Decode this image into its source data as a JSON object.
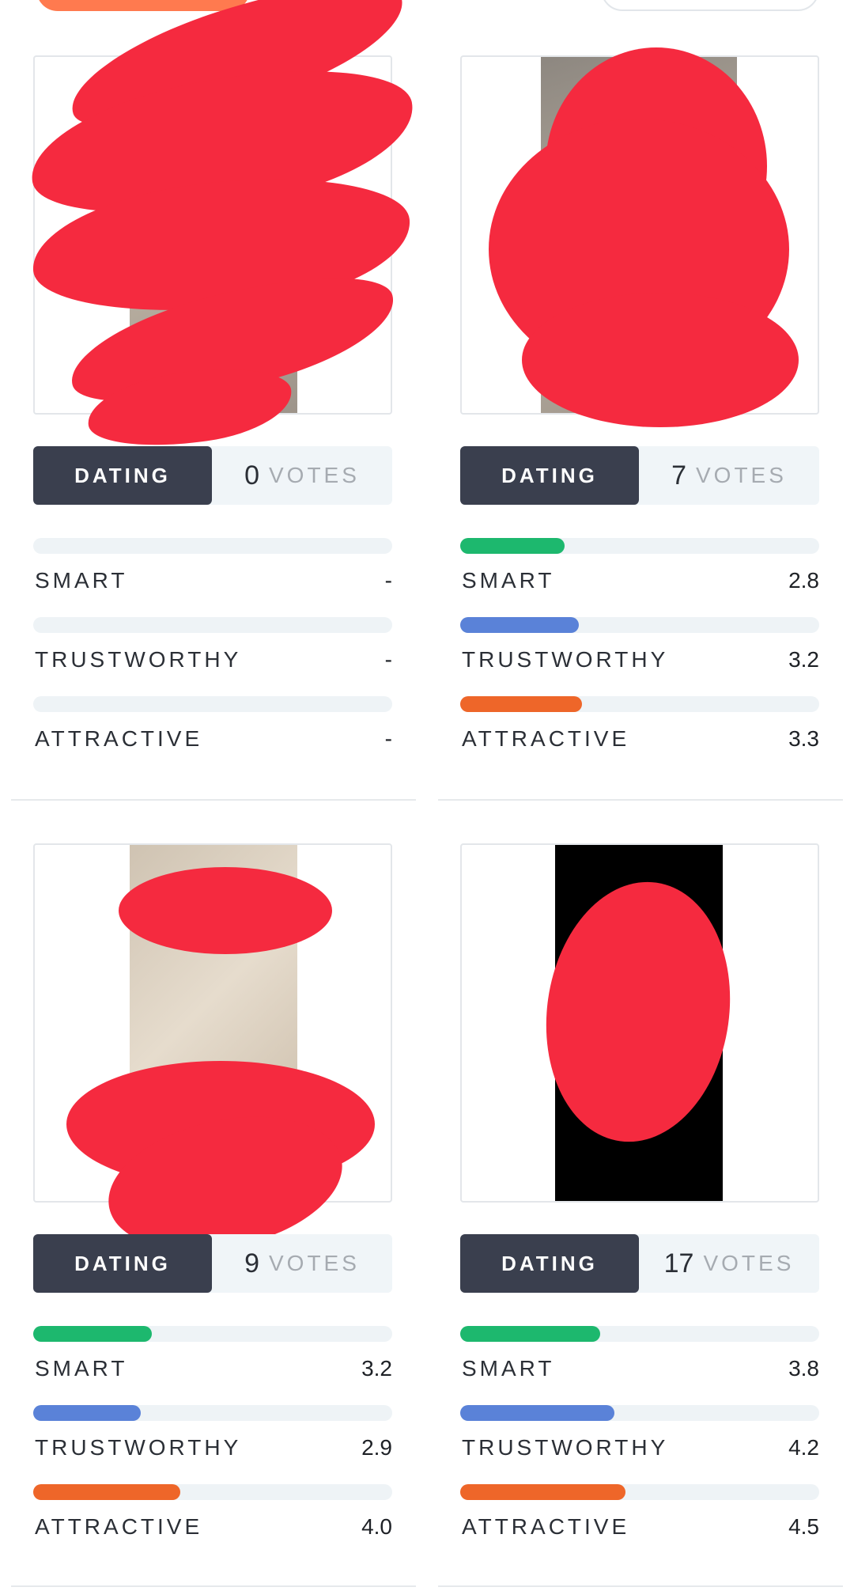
{
  "colors": {
    "smart": "#1db86e",
    "trustworthy": "#5a82d8",
    "attractive": "#ee6629",
    "tag_bg": "#3a3f4e",
    "redaction": "#f52a3f"
  },
  "cards": [
    {
      "tag": "DATING",
      "votes_count": "0",
      "votes_label": "VOTES",
      "metrics": [
        {
          "label": "SMART",
          "value": "-",
          "fill": 0
        },
        {
          "label": "TRUSTWORTHY",
          "value": "-",
          "fill": 0
        },
        {
          "label": "ATTRACTIVE",
          "value": "-",
          "fill": 0
        }
      ]
    },
    {
      "tag": "DATING",
      "votes_count": "7",
      "votes_label": "VOTES",
      "metrics": [
        {
          "label": "SMART",
          "value": "2.8",
          "fill": 0.29
        },
        {
          "label": "TRUSTWORTHY",
          "value": "3.2",
          "fill": 0.33
        },
        {
          "label": "ATTRACTIVE",
          "value": "3.3",
          "fill": 0.34
        }
      ]
    },
    {
      "tag": "DATING",
      "votes_count": "9",
      "votes_label": "VOTES",
      "metrics": [
        {
          "label": "SMART",
          "value": "3.2",
          "fill": 0.33
        },
        {
          "label": "TRUSTWORTHY",
          "value": "2.9",
          "fill": 0.3
        },
        {
          "label": "ATTRACTIVE",
          "value": "4.0",
          "fill": 0.41
        }
      ]
    },
    {
      "tag": "DATING",
      "votes_count": "17",
      "votes_label": "VOTES",
      "metrics": [
        {
          "label": "SMART",
          "value": "3.8",
          "fill": 0.39
        },
        {
          "label": "TRUSTWORTHY",
          "value": "4.2",
          "fill": 0.43
        },
        {
          "label": "ATTRACTIVE",
          "value": "4.5",
          "fill": 0.46
        }
      ]
    }
  ]
}
